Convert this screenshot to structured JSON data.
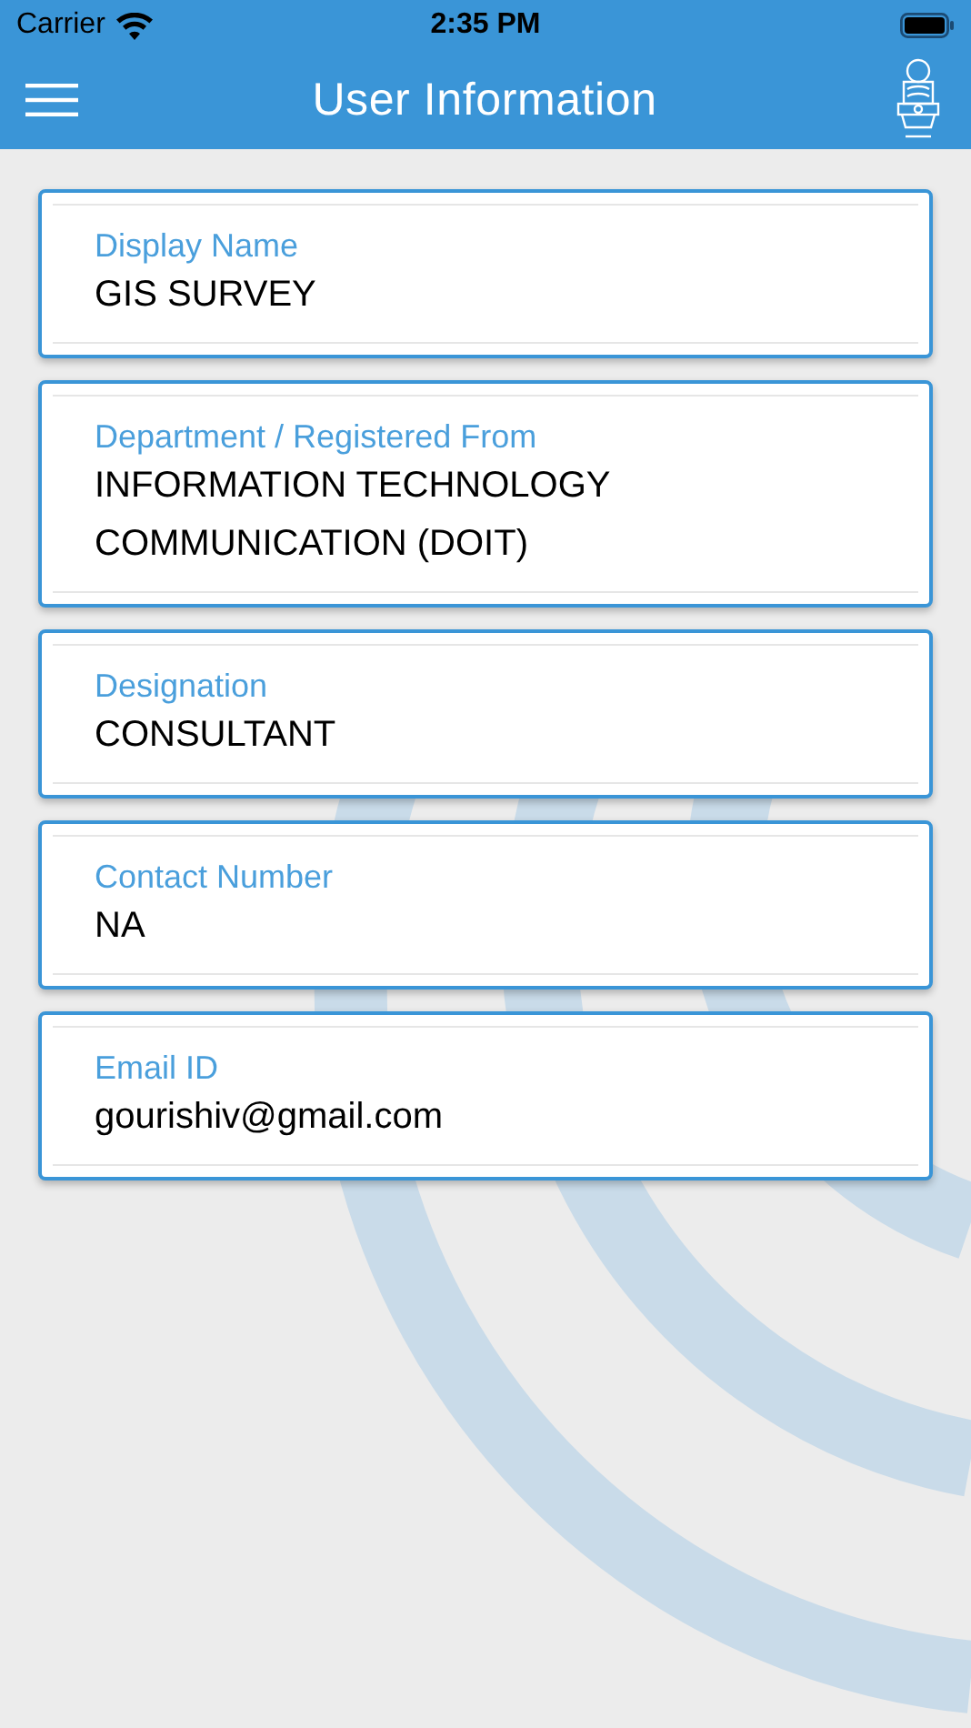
{
  "status_bar": {
    "carrier": "Carrier",
    "time": "2:35 PM"
  },
  "nav_bar": {
    "title": "User Information"
  },
  "fields": [
    {
      "label": "Display Name",
      "value": "GIS SURVEY"
    },
    {
      "label": "Department / Registered From",
      "value": "INFORMATION TECHNOLOGY COMMUNICATION (DOIT)"
    },
    {
      "label": "Designation",
      "value": "CONSULTANT"
    },
    {
      "label": "Contact Number",
      "value": "NA"
    },
    {
      "label": "Email ID",
      "value": "gourishiv@gmail.com"
    }
  ]
}
